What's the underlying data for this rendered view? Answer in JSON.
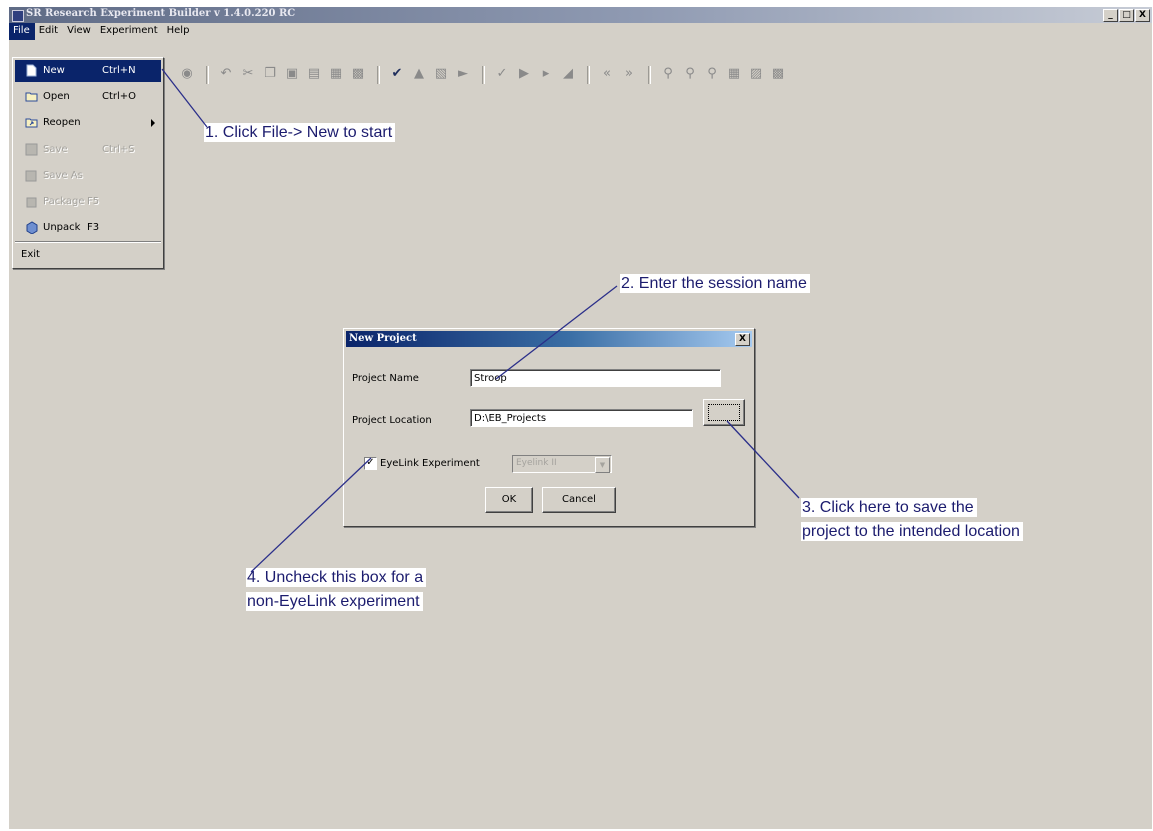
{
  "window": {
    "title": "SR Research Experiment Builder v 1.4.0.220 RC",
    "controls": {
      "minimize": "_",
      "maximize": "□",
      "close": "X"
    }
  },
  "menubar": [
    "File",
    "Edit",
    "View",
    "Experiment",
    "Help"
  ],
  "file_menu": {
    "items": [
      {
        "label": "New",
        "shortcut": "Ctrl+N",
        "icon": "new-document-icon",
        "selected": true,
        "enabled": true
      },
      {
        "label": "Open",
        "shortcut": "Ctrl+O",
        "icon": "open-folder-icon",
        "enabled": true
      },
      {
        "label": "Reopen",
        "shortcut": "",
        "icon": "reopen-icon",
        "submenu": true,
        "enabled": true
      },
      {
        "label": "Save",
        "shortcut": "Ctrl+S",
        "icon": "save-icon",
        "enabled": false
      },
      {
        "label": "Save As",
        "shortcut": "",
        "icon": "save-as-icon",
        "enabled": false
      },
      {
        "label": "Package",
        "shortcut": "F5",
        "icon": "package-icon",
        "enabled": false
      },
      {
        "label": "Unpack",
        "shortcut": "F3",
        "icon": "unpack-icon",
        "enabled": true
      },
      {
        "label": "Exit",
        "shortcut": "",
        "icon": "",
        "enabled": true
      }
    ]
  },
  "toolbar": {
    "icons": [
      "package-icon",
      "undo-icon",
      "cut-icon",
      "copy-icon",
      "paste-icon",
      "paste-special-icon",
      "delete-icon",
      "properties-icon",
      "check-icon",
      "build-icon",
      "test-icon",
      "deploy-icon",
      "validate-icon",
      "run-icon",
      "play-icon",
      "stop-icon",
      "rewind-icon",
      "fast-forward-icon",
      "zoom-fit-icon",
      "zoom-in-icon",
      "zoom-out-icon",
      "grid-icon",
      "layout-icon",
      "tile-icon"
    ]
  },
  "dialog": {
    "title": "New Project",
    "close_label": "X",
    "project_name_label": "Project Name",
    "project_name_value": "Stroop",
    "project_location_label": "Project Location",
    "project_location_value": "D:\\EB_Projects",
    "eyelink_checkbox_label": "EyeLink Experiment",
    "eyelink_checked": true,
    "eyelink_model": "Eyelink II",
    "ok_label": "OK",
    "cancel_label": "Cancel"
  },
  "annotations": {
    "step1": "1. Click File-> New to start",
    "step2": "2. Enter the session name",
    "step3_line1": "3. Click here to save the",
    "step3_line2": "project to the intended location",
    "step4_line1": "4. Uncheck this box for a",
    "step4_line2": "non-EyeLink experiment"
  },
  "colors": {
    "workspace": "#d4d0c8",
    "menu_highlight": "#0a246a",
    "annotation_text": "#1c1c6e",
    "callout_line": "#2b2f8a"
  }
}
